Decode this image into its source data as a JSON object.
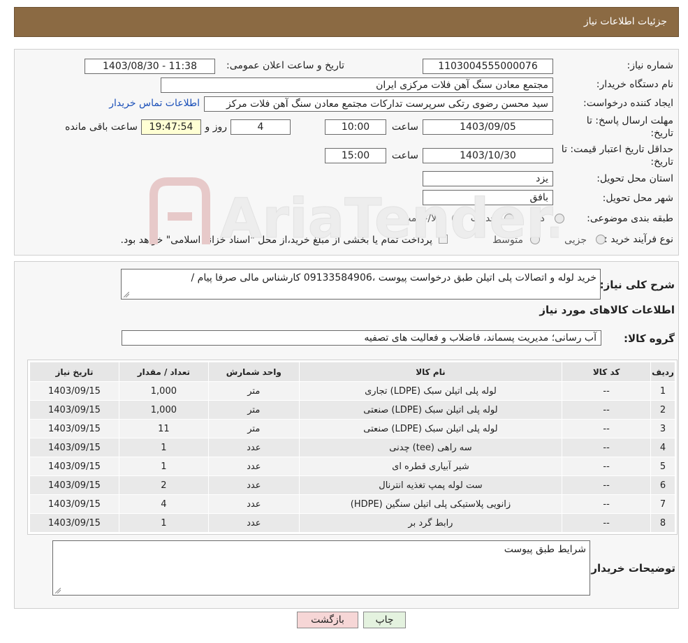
{
  "header": {
    "title": "جزئیات اطلاعات نیاز"
  },
  "form": {
    "need_number_label": "شماره نیاز:",
    "need_number": "1103004555000076",
    "announce_label": "تاریخ و ساعت اعلان عمومی:",
    "announce_value": "1403/08/30 - 11:38",
    "buyer_org_label": "نام دستگاه خریدار:",
    "buyer_org": "مجتمع معادن سنگ آهن فلات مرکزی ایران",
    "requester_label": "ایجاد کننده درخواست:",
    "requester": "سید محسن رضوی رتکی سرپرست تدارکات مجتمع معادن سنگ آهن فلات مرکز",
    "contact_link": "اطلاعات تماس خریدار",
    "deadline_label_1": "مهلت ارسال پاسخ: تا",
    "deadline_label_2": "تاریخ:",
    "deadline_date": "1403/09/05",
    "time_label": "ساعت",
    "deadline_time": "10:00",
    "days_value": "4",
    "days_label": "روز و",
    "remaining_time": "19:47:54",
    "remaining_label": "ساعت باقی مانده",
    "validity_label_1": "حداقل تاریخ اعتبار قیمت: تا",
    "validity_label_2": "تاریخ:",
    "validity_date": "1403/10/30",
    "validity_time": "15:00",
    "province_label": "استان محل تحویل:",
    "province": "یزد",
    "city_label": "شهر محل تحویل:",
    "city": "بافق",
    "category_label": "طبقه بندی موضوعی:",
    "category_options": [
      "کالا",
      "خدمت",
      "کالا/خدمت"
    ],
    "process_label": "نوع فرآیند خرید :",
    "process_options": [
      "جزیی",
      "متوسط"
    ],
    "payment_note": "پرداخت تمام یا بخشی از مبلغ خرید،از محل \"اسناد خزانه اسلامی\" خواهد بود."
  },
  "watermark": {
    "text": "AriaTender.neT"
  },
  "details": {
    "summary_label": "شرح کلی نیاز:",
    "summary": "خرید لوله و اتصالات پلی اتیلن طبق درخواست پیوست ،09133584906 کارشناس مالی صرفا پیام /",
    "goods_info_title": "اطلاعات کالاهای مورد نیاز",
    "goods_group_label": "گروه کالا:",
    "goods_group": "آب رسانی؛ مدیریت پسماند، فاضلاب و فعالیت های تصفیه"
  },
  "table": {
    "headers": [
      "ردیف",
      "کد کالا",
      "نام کالا",
      "واحد شمارش",
      "تعداد / مقدار",
      "تاریخ نیاز"
    ],
    "rows": [
      [
        "1",
        "--",
        "لوله پلی اتیلن سبک (LDPE) تجاری",
        "متر",
        "1,000",
        "1403/09/15"
      ],
      [
        "2",
        "--",
        "لوله پلی اتیلن سبک (LDPE) صنعتی",
        "متر",
        "1,000",
        "1403/09/15"
      ],
      [
        "3",
        "--",
        "لوله پلی اتیلن سبک (LDPE) صنعتی",
        "متر",
        "11",
        "1403/09/15"
      ],
      [
        "4",
        "--",
        "سه راهی (tee) چدنی",
        "عدد",
        "1",
        "1403/09/15"
      ],
      [
        "5",
        "--",
        "شیر آبیاری قطره ای",
        "عدد",
        "1",
        "1403/09/15"
      ],
      [
        "6",
        "--",
        "ست لوله پمپ تغذیه انترنال",
        "عدد",
        "2",
        "1403/09/15"
      ],
      [
        "7",
        "--",
        "زانویی پلاستیکی پلی اتیلن سنگین (HDPE)",
        "عدد",
        "4",
        "1403/09/15"
      ],
      [
        "8",
        "--",
        "رابط گرد بر",
        "عدد",
        "1",
        "1403/09/15"
      ]
    ]
  },
  "notes": {
    "label": "توضیحات خریدار:",
    "value": "شرایط طبق پیوست"
  },
  "buttons": {
    "print": "چاپ",
    "back": "بازگشت"
  },
  "colors": {
    "header_bg": "#8b6a43",
    "link": "#1a4fb8",
    "back_button": "#f6d6d6",
    "print_button": "#e4f2df"
  }
}
